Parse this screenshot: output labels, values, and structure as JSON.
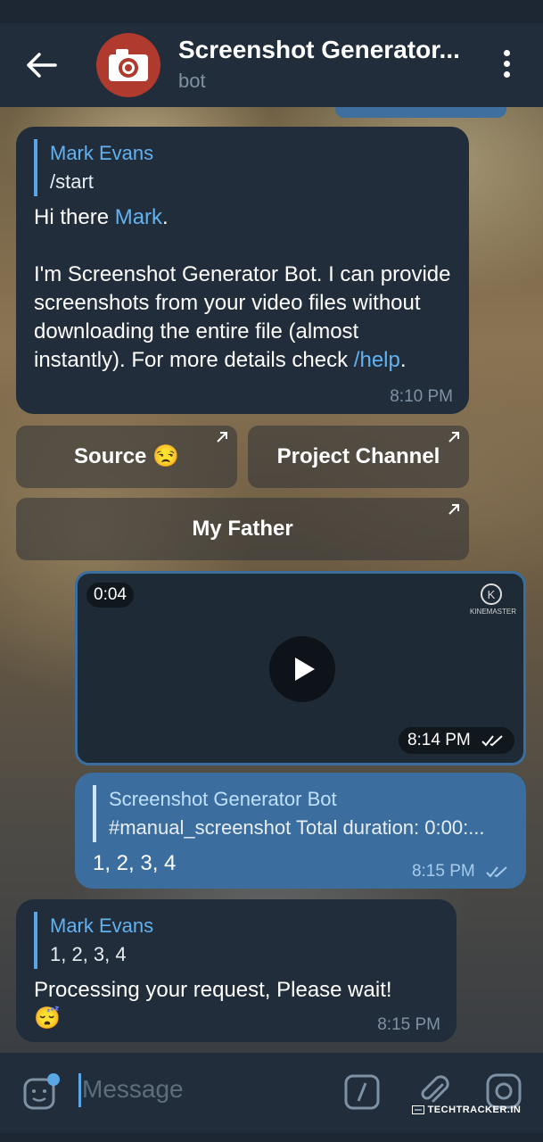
{
  "header": {
    "title": "Screenshot Generator...",
    "subtitle": "bot"
  },
  "messages": {
    "welcome": {
      "quote_name": "Mark Evans",
      "quote_text": "/start",
      "greeting_prefix": "Hi there ",
      "greeting_link": "Mark",
      "greeting_suffix": ".",
      "body_before_link": "I'm Screenshot Generator Bot. I can provide screenshots from your video files without downloading the entire file (almost instantly). For more details check ",
      "body_link": "/help",
      "body_after_link": ".",
      "time": "8:10 PM"
    },
    "keyboard": {
      "source": "Source 😒",
      "project_channel": "Project Channel",
      "my_father": "My Father"
    },
    "video": {
      "duration": "0:04",
      "watermark": "KINEMASTER",
      "time": "8:14 PM"
    },
    "reply_out": {
      "quote_name": "Screenshot Generator Bot",
      "quote_text": "#manual_screenshot  Total duration: 0:00:...",
      "text": "1, 2, 3, 4",
      "time": "8:15 PM"
    },
    "processing": {
      "quote_name": "Mark Evans",
      "quote_text": "1, 2, 3, 4",
      "text": "Processing your request, Please wait!",
      "emoji": "😴",
      "time": "8:15 PM"
    }
  },
  "input": {
    "placeholder": "Message"
  },
  "credit": "TECHTRACKER.IN",
  "colors": {
    "header_bg": "#212d3b",
    "incoming_bubble": "#212d3b",
    "outgoing_bubble": "#3b6e9f",
    "link": "#62b2f0",
    "accent": "#5aa7e6"
  }
}
